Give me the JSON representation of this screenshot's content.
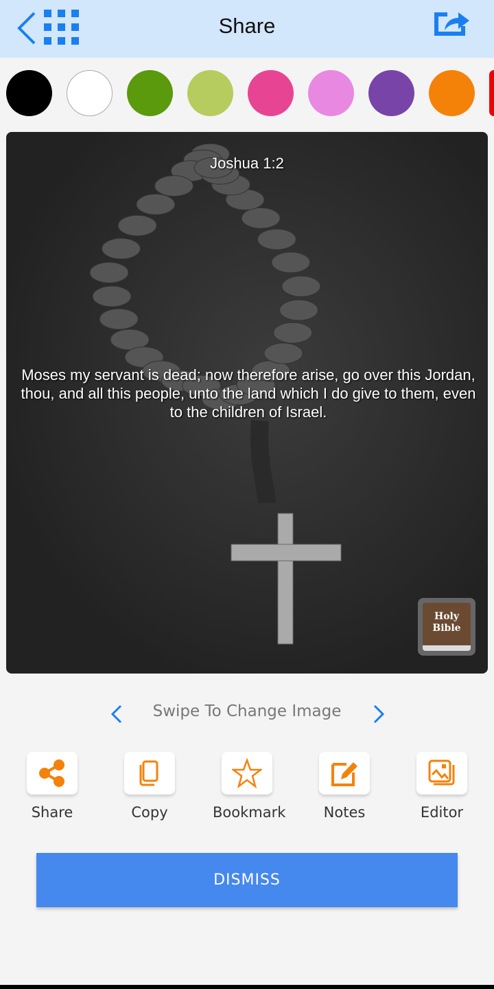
{
  "header": {
    "title": "Share",
    "back_icon": "chevron-left-icon",
    "grid_icon": "grid-icon",
    "share_icon": "share-external-icon",
    "accent": "#1a7ff0"
  },
  "colors": [
    "#000000",
    "#ffffff",
    "#5a9a0c",
    "#b6cc5e",
    "#e84494",
    "#e888e0",
    "#7844a8",
    "#f58208",
    "#f00000"
  ],
  "card": {
    "reference": "Joshua 1:2",
    "verse": "Moses my servant is dead; now therefore arise, go over this Jordan, thou, and all this people, unto the land which I do give to them, even to the children of Israel.",
    "logo_text": "Holy Bible"
  },
  "swipe": {
    "label": "Swipe To Change Image"
  },
  "actions": [
    {
      "label": "Share",
      "icon": "share-icon"
    },
    {
      "label": "Copy",
      "icon": "copy-icon"
    },
    {
      "label": "Bookmark",
      "icon": "star-icon"
    },
    {
      "label": "Notes",
      "icon": "edit-icon"
    },
    {
      "label": "Editor",
      "icon": "image-editor-icon"
    }
  ],
  "action_color": "#f58208",
  "dismiss": {
    "label": "DISMISS"
  }
}
